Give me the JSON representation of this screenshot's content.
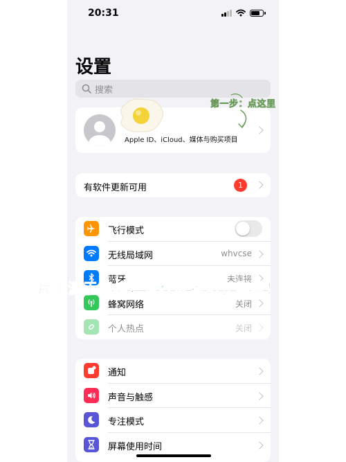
{
  "status_bar": {
    "time": "20:31",
    "battery_level": 0.8
  },
  "page": {
    "title": "设置"
  },
  "search": {
    "placeholder": "搜索"
  },
  "profile": {
    "subtitle": "Apple ID、iCloud、媒体与购买项目"
  },
  "update": {
    "label": "有软件更新可用",
    "badge": "1"
  },
  "network": {
    "airplane": {
      "label": "飞行模式",
      "toggle_on": false
    },
    "wifi": {
      "label": "无线局域网",
      "value": "whvcse"
    },
    "bluetooth": {
      "label": "蓝牙",
      "value": "未连接"
    },
    "cellular": {
      "label": "蜂窝网络",
      "value": "关闭"
    },
    "hotspot": {
      "label": "个人热点",
      "value": "关闭"
    }
  },
  "notify_group": {
    "notifications": {
      "label": "通知"
    },
    "sounds": {
      "label": "声音与触感"
    },
    "focus": {
      "label": "专注模式"
    },
    "screen_time": {
      "label": "屏幕使用时间"
    }
  },
  "overlays": {
    "annotation": "第一步：点这里",
    "watermark": "图片来源于网络，侵权联系站长删除！"
  },
  "colors": {
    "airplane": "#ff9500",
    "wifi": "#007aff",
    "bluetooth": "#007aff",
    "cellular": "#34c759",
    "hotspot": "#34c759",
    "notifications": "#ff3b30",
    "sounds": "#ff2d55",
    "focus": "#5856d6",
    "screen_time": "#5856d6",
    "badge": "#ff3b30"
  }
}
